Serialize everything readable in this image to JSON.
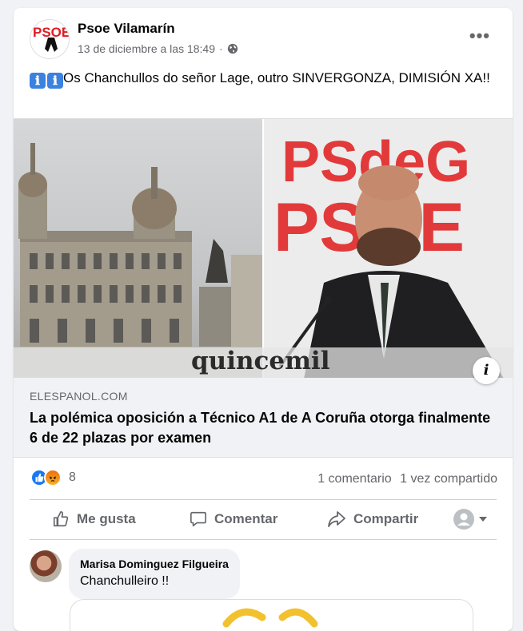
{
  "post": {
    "author": "Psoe Vilamarín",
    "timestamp": "13 de diciembre a las 18:49",
    "separator": "·",
    "privacy_icon": "globe-icon",
    "more_icon": "more-options-icon",
    "avatar_text": "PSOE",
    "text": "Os Chanchullos do señor Lage, outro SINVERGONZA, DIMISIÓN XA!!",
    "emoji": "ℹ"
  },
  "link": {
    "image_brand": "quincemil",
    "image_sign_line1": "PSdeG",
    "image_sign_line2": "PSOE",
    "domain": "ELESPANOL.COM",
    "headline": "La polémica oposición a Técnico A1 de A Coruña otorga finalmente 6 de 22 plazas por examen",
    "info_icon": "i"
  },
  "stats": {
    "reaction_count": "8",
    "comments": "1 comentario",
    "shares": "1 vez compartido"
  },
  "actions": {
    "like": "Me gusta",
    "comment": "Comentar",
    "share": "Compartir"
  },
  "comment": {
    "author": "Marisa Dominguez Filgueira",
    "text": "Chanchulleiro !!"
  },
  "colors": {
    "like_blue": "#1877f2",
    "text_secondary": "#65676b",
    "psoe_red": "#e11b22"
  }
}
